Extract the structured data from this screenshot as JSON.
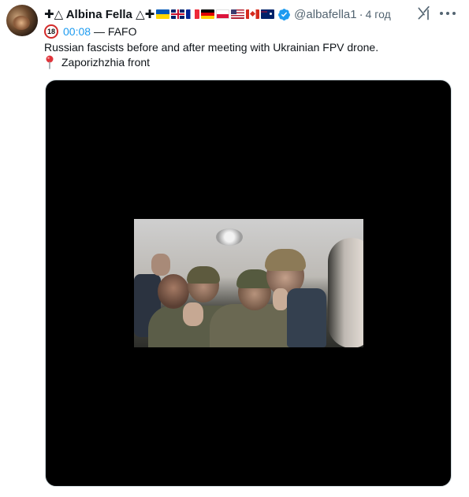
{
  "author": {
    "name": "✚△ Albina Fella △✚",
    "handle": "@albafella1",
    "separator": "·",
    "time": "4 год",
    "flags": [
      "ukraine-flag",
      "uk-flag",
      "france-flag",
      "germany-flag",
      "poland-flag",
      "usa-flag",
      "canada-flag",
      "australia-flag"
    ]
  },
  "tweet": {
    "age_badge": "18",
    "timecode": "00:08",
    "timecode_suffix": "— FAFO",
    "text_line1": "Russian fascists before and after meeting with Ukrainian FPV drone.",
    "text_line2": "Zaporizhzhia front"
  },
  "icons": {
    "grok": "grok-icon",
    "more": "more-icon",
    "verified": "verified-badge-icon",
    "pin": "round-pushpin-icon"
  },
  "colors": {
    "accent": "#1d9bf0",
    "text": "#0f1419",
    "secondary": "#536471",
    "video_bg": "#000000",
    "badge_red": "#d32a2a"
  }
}
